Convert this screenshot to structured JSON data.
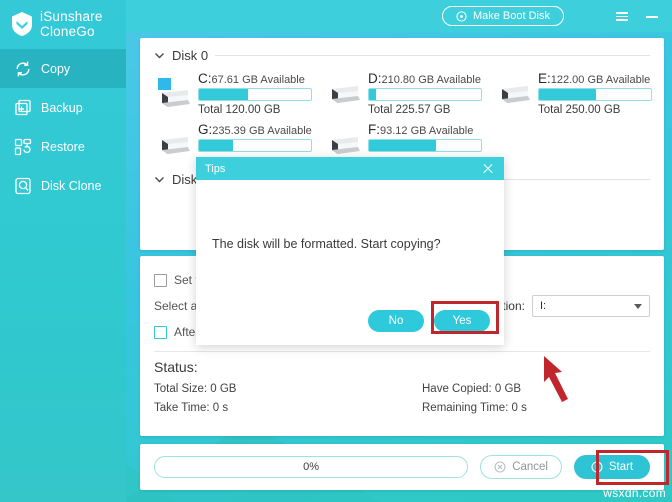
{
  "app": {
    "brand_line1": "iSunshare",
    "brand_line2": "CloneGo",
    "watermark": "wsxdn.com"
  },
  "sidebar": {
    "items": [
      {
        "label": "Copy",
        "icon": "refresh-icon",
        "active": true
      },
      {
        "label": "Backup",
        "icon": "backup-icon",
        "active": false
      },
      {
        "label": "Restore",
        "icon": "restore-icon",
        "active": false
      },
      {
        "label": "Disk Clone",
        "icon": "disk-clone-icon",
        "active": false
      }
    ]
  },
  "topbar": {
    "make_boot_disk": "Make Boot Disk",
    "menu_icon": "hamburger-menu-icon",
    "minimize_icon": "minimize-icon"
  },
  "disk_panel": {
    "group0_title": "Disk 0",
    "group1_title": "Disk",
    "drives": [
      {
        "letter": "C:",
        "available": "67.61 GB Available",
        "total": "Total 120.00 GB",
        "fill_pct": 44,
        "system": true
      },
      {
        "letter": "D:",
        "available": "210.80 GB Available",
        "total": "Total 225.57 GB",
        "fill_pct": 6,
        "system": false
      },
      {
        "letter": "E:",
        "available": "122.00 GB Available",
        "total": "Total 250.00 GB",
        "fill_pct": 51,
        "system": false
      },
      {
        "letter": "G:",
        "available": "235.39 GB Available",
        "total": "",
        "fill_pct": 30,
        "system": false
      },
      {
        "letter": "F:",
        "available": "93.12 GB Available",
        "total": "",
        "fill_pct": 60,
        "system": false
      }
    ]
  },
  "options": {
    "set_checkbox_label": "Set t",
    "select_label": "Select a",
    "after_checkbox_label": "After",
    "partition_label": "artition:",
    "partition_value": "I:"
  },
  "status": {
    "title": "Status:",
    "total_size": "Total Size: 0 GB",
    "have_copied": "Have Copied: 0 GB",
    "take_time": "Take Time: 0 s",
    "remaining_time": "Remaining Time: 0 s"
  },
  "bottom": {
    "progress_text": "0%",
    "cancel_label": "Cancel",
    "start_label": "Start",
    "cancel_icon": "cancel-circle-icon",
    "start_icon": "play-circle-icon"
  },
  "modal": {
    "title": "Tips",
    "message": "The disk will be formatted. Start copying?",
    "no_label": "No",
    "yes_label": "Yes",
    "close_icon": "close-icon"
  },
  "colors": {
    "accent": "#33cada",
    "topbar": "#3ecfdd",
    "sidebar_active": "#27b3bf",
    "highlight": "#c0272d"
  }
}
